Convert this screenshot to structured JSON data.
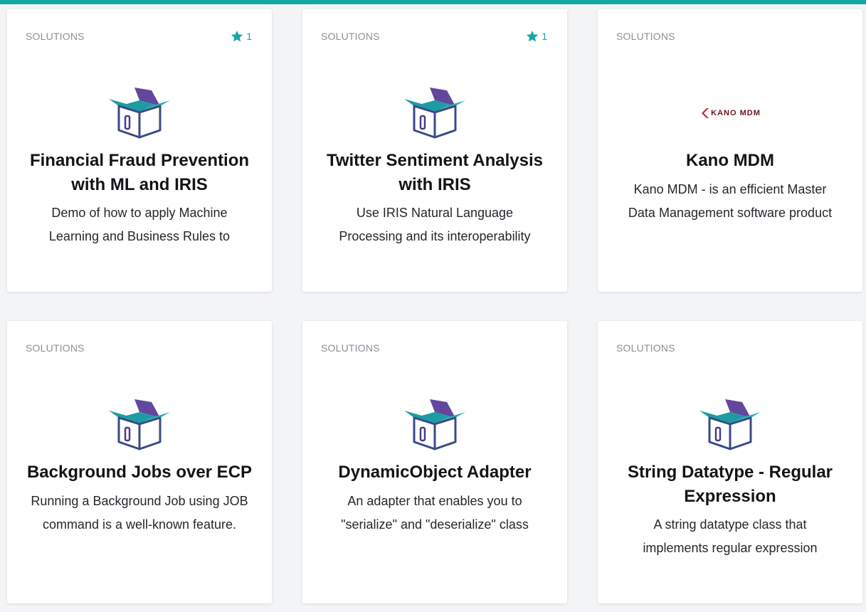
{
  "colors": {
    "accent": "#14a8a4",
    "box_teal": "#1d9ca3",
    "box_purple": "#5a3e97",
    "kano_red": "#c1272d"
  },
  "cards": [
    {
      "category": "SOLUTIONS",
      "stars": "1",
      "logo": "package-box-icon",
      "title_lines": [
        "Financial Fraud Prevention",
        "with ML and IRIS"
      ],
      "desc_lines": [
        "Demo of how to apply Machine",
        "Learning and Business Rules to"
      ]
    },
    {
      "category": "SOLUTIONS",
      "stars": "1",
      "logo": "package-box-icon",
      "title_lines": [
        "Twitter Sentiment Analysis",
        "with IRIS"
      ],
      "desc_lines": [
        "Use IRIS Natural Language",
        "Processing and its interoperability"
      ]
    },
    {
      "category": "SOLUTIONS",
      "stars": "",
      "logo": "kano-mdm-logo",
      "logo_text": "KANO MDM",
      "title_lines": [
        "Kano MDM"
      ],
      "desc_lines": [
        "Kano MDM - is an efficient Master",
        "Data Management software product"
      ]
    },
    {
      "category": "SOLUTIONS",
      "stars": "",
      "logo": "package-box-icon",
      "title_lines": [
        "Background Jobs over ECP"
      ],
      "desc_lines": [
        "Running a Background Job using JOB",
        "command is a well-known feature."
      ]
    },
    {
      "category": "SOLUTIONS",
      "stars": "",
      "logo": "package-box-icon",
      "title_lines": [
        "DynamicObject Adapter"
      ],
      "desc_lines": [
        "An adapter that enables you to",
        "\"serialize\" and \"deserialize\" class"
      ]
    },
    {
      "category": "SOLUTIONS",
      "stars": "",
      "logo": "package-box-icon",
      "title_lines": [
        "String Datatype - Regular",
        "Expression"
      ],
      "desc_lines": [
        "A string datatype class that",
        "implements regular expression"
      ]
    }
  ]
}
